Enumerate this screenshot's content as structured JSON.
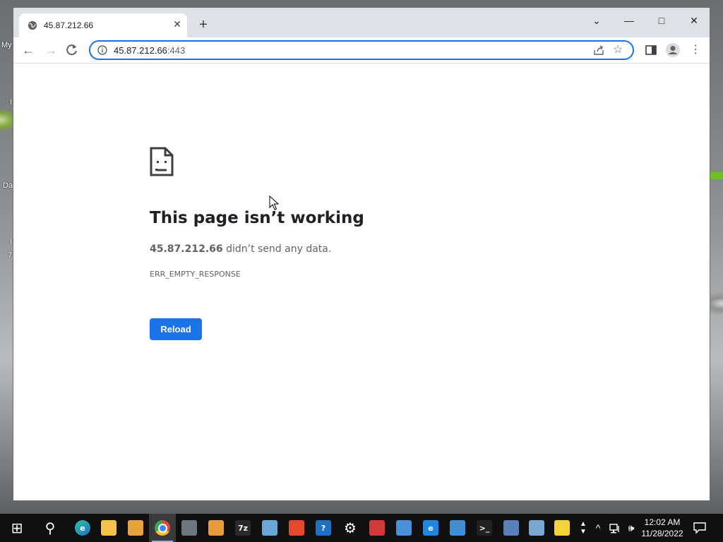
{
  "desktop": {
    "labels": [
      "My",
      "I",
      "Da",
      "I",
      "7"
    ]
  },
  "browser": {
    "tab": {
      "title": "45.87.212.66"
    },
    "address": {
      "host": "45.87.212.66",
      "port": ":443"
    },
    "window_controls": {
      "tab_search": "⌄",
      "minimize": "—",
      "maximize": "□",
      "close": "✕"
    }
  },
  "error_page": {
    "title": "This page isn’t working",
    "host": "45.87.212.66",
    "description_suffix": " didn’t send any data.",
    "error_code": "ERR_EMPTY_RESPONSE",
    "reload_label": "Reload"
  },
  "taskbar": {
    "apps": [
      {
        "name": "start-icon",
        "glyph": "⊞",
        "color": "#101010"
      },
      {
        "name": "search-icon",
        "glyph": "⚲",
        "color": "#101010"
      },
      {
        "name": "edge-icon",
        "glyph": "e",
        "color": "#1f8fd6"
      },
      {
        "name": "file-explorer-icon",
        "glyph": "",
        "color": "#f2c14e"
      },
      {
        "name": "store-icon",
        "glyph": "",
        "color": "#e8a33a"
      },
      {
        "name": "chrome-icon",
        "glyph": "",
        "color": "#dd4b39"
      },
      {
        "name": "calculator-icon",
        "glyph": "",
        "color": "#6d7780"
      },
      {
        "name": "media-player-icon",
        "glyph": "",
        "color": "#e89b3a"
      },
      {
        "name": "7zip-icon",
        "glyph": "7z",
        "color": "#2a2a2a"
      },
      {
        "name": "photos-icon",
        "glyph": "",
        "color": "#6aa6d8"
      },
      {
        "name": "maps-icon",
        "glyph": "",
        "color": "#e24a2b"
      },
      {
        "name": "help-icon",
        "glyph": "?",
        "color": "#1f6fc2"
      },
      {
        "name": "settings-icon",
        "glyph": "⚙",
        "color": "#101010"
      },
      {
        "name": "paint-icon",
        "glyph": "",
        "color": "#d23a3a"
      },
      {
        "name": "remote-desktop-icon",
        "glyph": "",
        "color": "#4a90d9"
      },
      {
        "name": "internet-explorer-icon",
        "glyph": "e",
        "color": "#1e88e5"
      },
      {
        "name": "system-info-icon",
        "glyph": "",
        "color": "#3d8fd1"
      },
      {
        "name": "terminal-icon",
        "glyph": ">_",
        "color": "#222"
      },
      {
        "name": "network-icon",
        "glyph": "",
        "color": "#5b7fb8"
      },
      {
        "name": "pen-icon",
        "glyph": "",
        "color": "#7aa7d0"
      },
      {
        "name": "sticky-notes-icon",
        "glyph": "",
        "color": "#f5d33a"
      }
    ],
    "clock": {
      "time": "12:02 AM",
      "date": "11/28/2022"
    }
  }
}
